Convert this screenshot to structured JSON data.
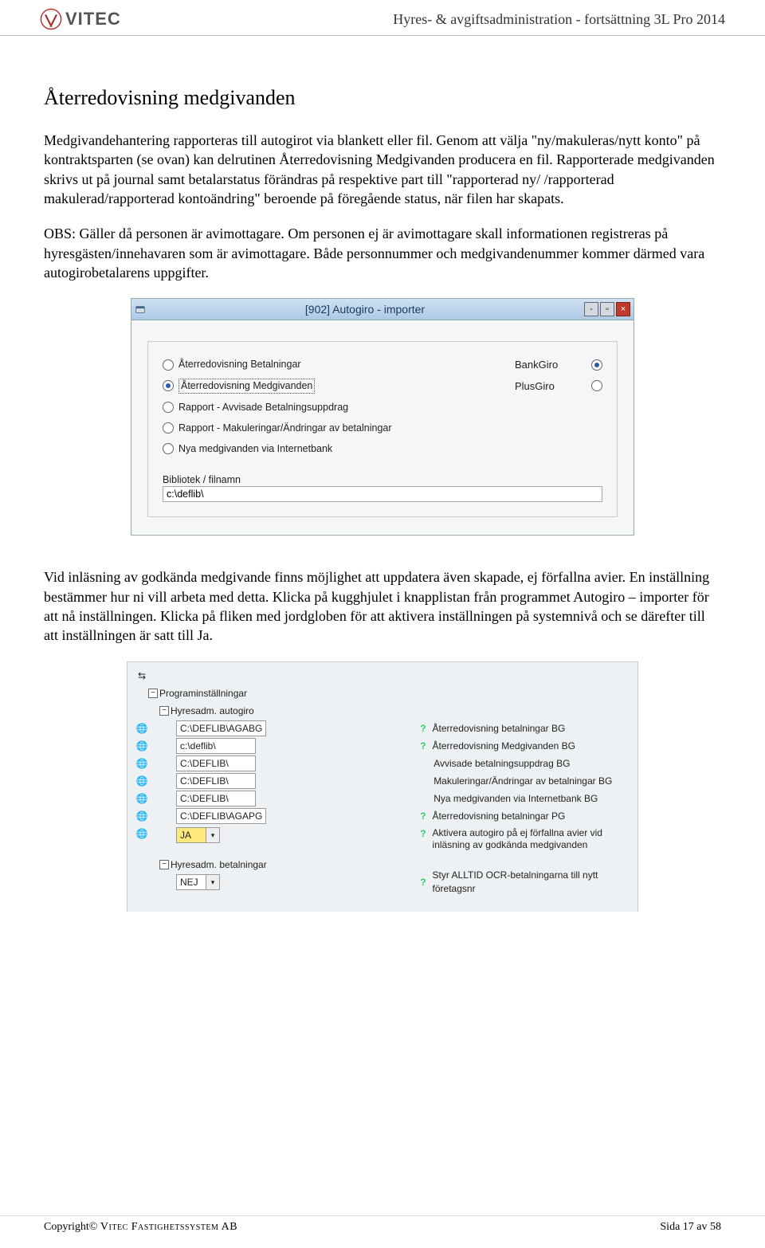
{
  "header": {
    "logo_text": "VITEC",
    "right": "Hyres- & avgiftsadministration - fortsättning 3L Pro 2014"
  },
  "body": {
    "heading": "Återredovisning medgivanden",
    "p1": "Medgivandehantering rapporteras till autogirot via blankett eller fil. Genom att välja \"ny/makuleras/nytt konto\" på kontraktsparten (se ovan) kan delrutinen Återredovisning Medgivanden producera en fil. Rapporterade medgivanden skrivs ut på journal samt betalarstatus förändras på respektive part till \"rapporterad ny/  /rapporterad makulerad/rapporterad kontoändring\" beroende på föregående status, när filen har skapats.",
    "p2": "OBS: Gäller då personen är avimottagare. Om personen ej är avimottagare skall informationen registreras på hyresgästen/innehavaren som är avimottagare. Både personnummer och medgivandenummer kommer därmed vara autogirobetalarens uppgifter.",
    "p3": "Vid inläsning av godkända medgivande finns möjlighet att uppdatera även skapade, ej förfallna avier. En inställning bestämmer hur ni vill arbeta med detta. Klicka på kugghjulet i knapplistan från programmet Autogiro – importer för att nå inställningen. Klicka på fliken med jordgloben för att aktivera inställningen på systemnivå och se därefter till att inställningen är satt till Ja."
  },
  "win1": {
    "title": "[902]  Autogiro - importer",
    "radios": [
      "Återredovisning Betalningar",
      "Återredovisning Medgivanden",
      "Rapport - Avvisade Betalningsuppdrag",
      "Rapport - Makuleringar/Ändringar av betalningar",
      "Nya medgivanden via Internetbank"
    ],
    "selected_radio": 1,
    "giro": {
      "bank": "BankGiro",
      "plus": "PlusGiro",
      "selected": "bank"
    },
    "filelabel": "Bibliotek / filnamn",
    "filevalue": "c:\\deflib\\"
  },
  "win2": {
    "top": "Programinställningar",
    "grp1": "Hyresadm. autogiro",
    "rows": [
      {
        "val": "C:\\DEFLIB\\AGABG",
        "right": "Återredovisning betalningar BG",
        "q": true
      },
      {
        "val": "c:\\deflib\\",
        "right": "Återredovisning Medgivanden BG",
        "q": true
      },
      {
        "val": "C:\\DEFLIB\\",
        "right": "Avvisade betalningsuppdrag BG",
        "q": false
      },
      {
        "val": "C:\\DEFLIB\\",
        "right": "Makuleringar/Ändringar av betalningar BG",
        "q": false
      },
      {
        "val": "C:\\DEFLIB\\",
        "right": "Nya medgivanden via Internetbank BG",
        "q": false
      },
      {
        "val": "C:\\DEFLIB\\AGAPG",
        "right": "Återredovisning betalningar PG",
        "q": true
      }
    ],
    "ja": {
      "val": "JA",
      "right": "Aktivera autogiro på ej förfallna avier vid inläsning av godkända medgivanden",
      "q": true
    },
    "grp2": "Hyresadm. betalningar",
    "nej": {
      "val": "NEJ",
      "right": "Styr ALLTID OCR-betalningarna till nytt företagsnr",
      "q": true
    }
  },
  "footer": {
    "left_prefix": "Copyright© ",
    "left_caps": "Vitec Fastighetssystem AB",
    "right": "Sida 17 av 58"
  }
}
